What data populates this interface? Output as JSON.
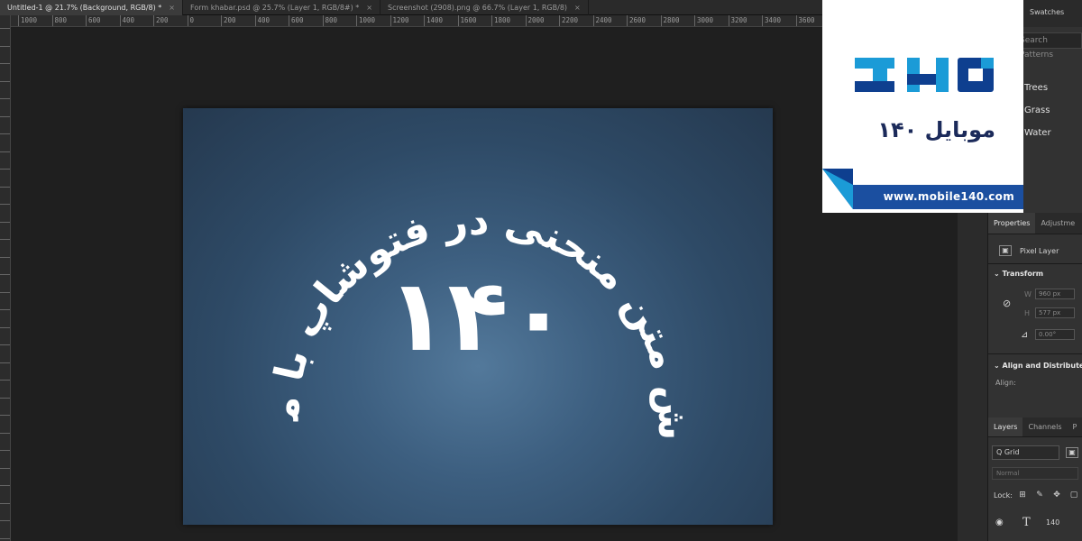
{
  "tabs": [
    {
      "label": "Untitled-1 @ 21.7% (Background, RGB/8) *",
      "active": true
    },
    {
      "label": "Form khabar.psd @ 25.7% (Layer 1, RGB/8#) *",
      "active": false
    },
    {
      "label": "Screenshot (2908).png @ 66.7% (Layer 1, RGB/8)",
      "active": false
    }
  ],
  "ruler": {
    "labels": [
      "1000",
      "800",
      "600",
      "400",
      "200",
      "0",
      "200",
      "400",
      "600",
      "800",
      "1000",
      "1200",
      "1400",
      "1600",
      "1800",
      "2000",
      "2200",
      "2400",
      "2600",
      "2800",
      "3000",
      "3200",
      "3400",
      "3600"
    ]
  },
  "canvas": {
    "arc_text": "آموزش متن منحنی در فتوشاپ با موبایل",
    "center_number": "۱۴۰"
  },
  "right_panel": {
    "swatches_tab": "Swatches",
    "search_patterns": "Search Patterns",
    "pattern_groups": [
      "Trees",
      "Grass",
      "Water"
    ],
    "properties_tab": "Properties",
    "adjustments_tab": "Adjustme",
    "pixel_layer": "Pixel Layer",
    "transform_label": "Transform",
    "w_label": "W",
    "w_value": "960 px",
    "h_label": "H",
    "h_value": "577 px",
    "angle_value": "0.00°",
    "align_label": "Align and Distribute",
    "align_sub": "Align:",
    "layers_tab": "Layers",
    "channels_tab": "Channels",
    "layers_tab3": "P",
    "filter_kind": "Q Grid",
    "blend_mode": "Normal",
    "lock_label": "Lock:",
    "layer_name": "140"
  },
  "logo": {
    "fa_text": "موبایل ۱۴۰",
    "url": "www.mobile140.com",
    "brand_color": "#1b4fa0"
  }
}
